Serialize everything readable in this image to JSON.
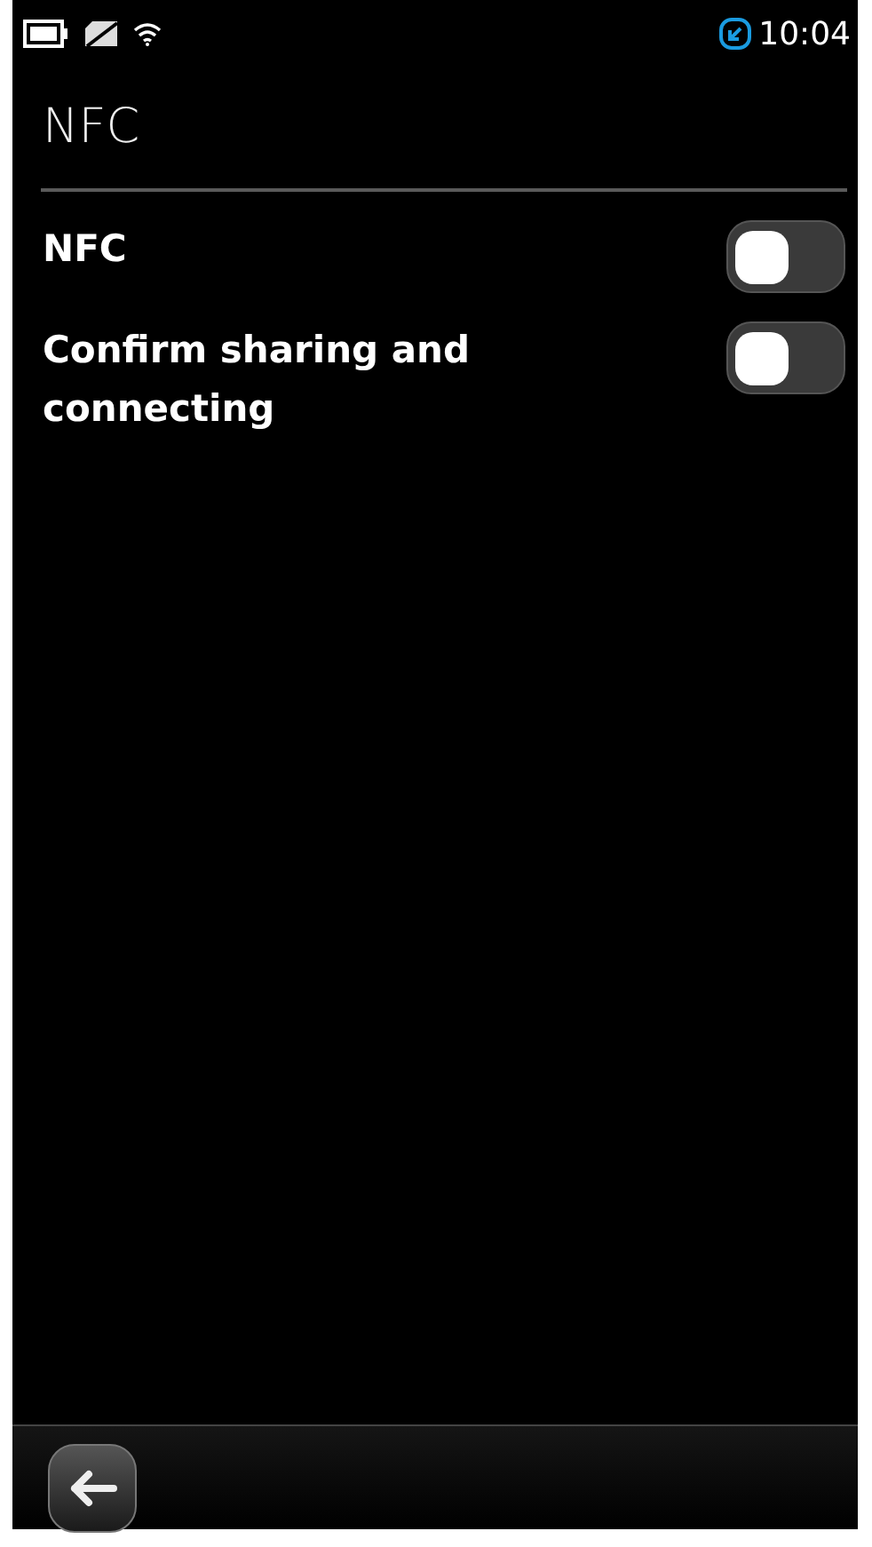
{
  "status_bar": {
    "time": "10:04"
  },
  "title": "NFC",
  "settings": [
    {
      "label": "NFC",
      "on": false
    },
    {
      "label": "Confirm sharing and connecting",
      "on": false
    }
  ]
}
